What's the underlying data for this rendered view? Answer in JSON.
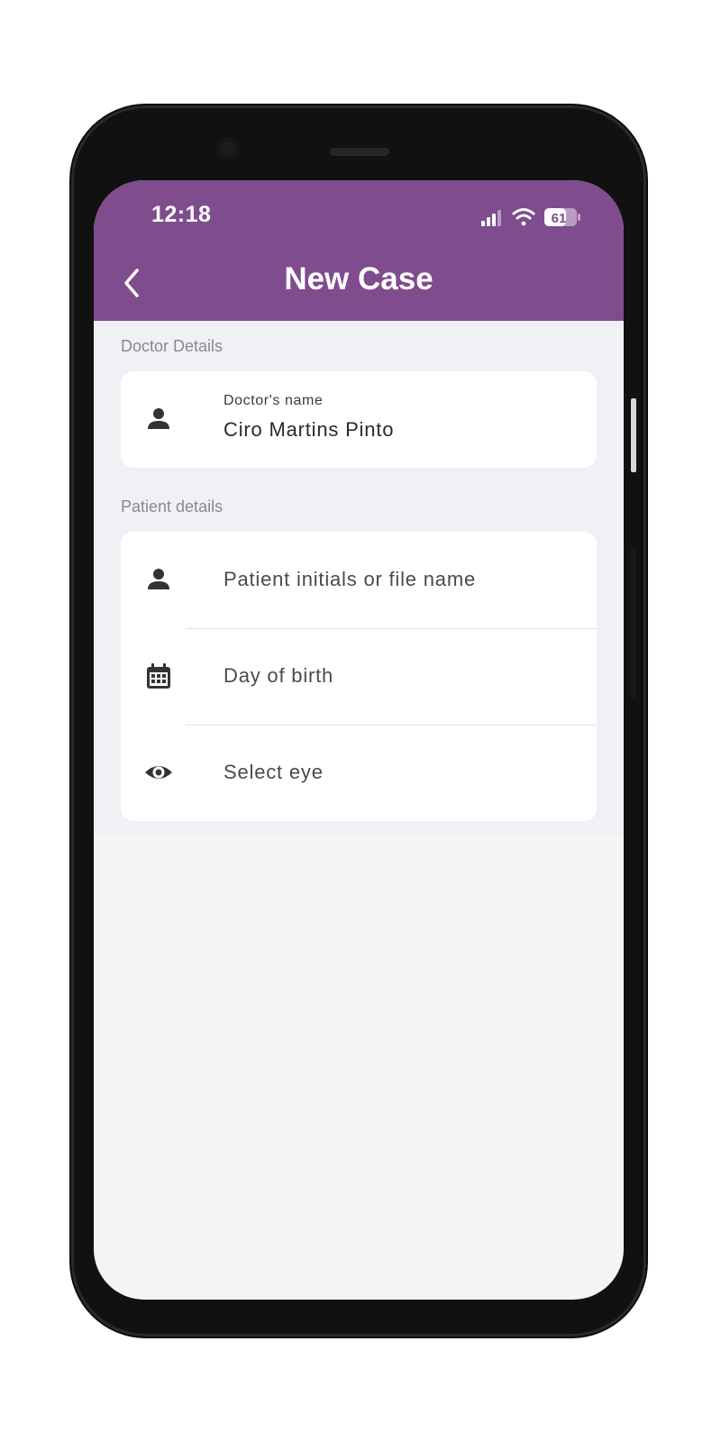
{
  "status_bar": {
    "time": "12:18",
    "battery": "61",
    "icons": [
      "cellular-signal-icon",
      "wifi-icon",
      "battery-icon"
    ]
  },
  "header": {
    "title": "New Case",
    "back_icon": "chevron-left-icon",
    "color": "#7f4c8e"
  },
  "doctor_section": {
    "label": "Doctor Details",
    "field": {
      "icon": "person-icon",
      "label": "Doctor's name",
      "value": "Ciro Martins Pinto"
    }
  },
  "patient_section": {
    "label": "Patient details",
    "fields": [
      {
        "icon": "person-icon",
        "placeholder": "Patient initials or file name"
      },
      {
        "icon": "calendar-icon",
        "placeholder": "Day of birth"
      },
      {
        "icon": "eye-icon",
        "placeholder": "Select eye"
      }
    ]
  }
}
